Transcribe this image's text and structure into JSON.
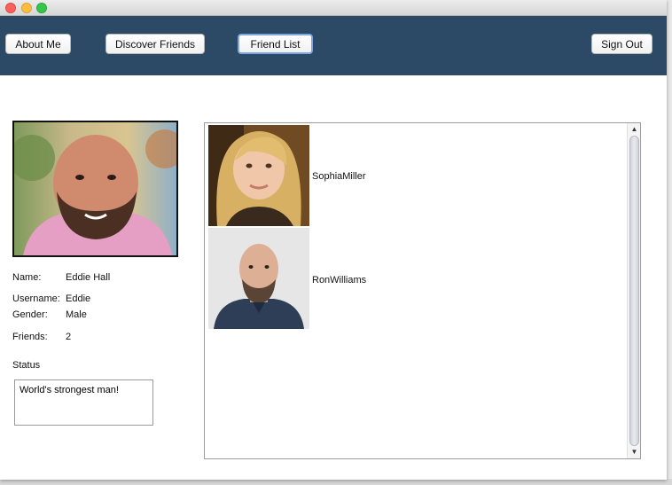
{
  "nav": {
    "about_me": "About Me",
    "discover_friends": "Discover Friends",
    "friend_list": "Friend List",
    "sign_out": "Sign Out"
  },
  "profile": {
    "name_label": "Name:",
    "name_value": "Eddie Hall",
    "username_label": "Username:",
    "username_value": "Eddie",
    "gender_label": "Gender:",
    "gender_value": "Male",
    "friends_label": "Friends:",
    "friends_value": "2",
    "status_label": "Status",
    "status_text": "World's strongest man!"
  },
  "friends": [
    {
      "name": "SophiaMiller"
    },
    {
      "name": "RonWilliams"
    }
  ],
  "colors": {
    "navbar": "#2c4966",
    "active_button_border": "#7ca7df"
  },
  "icons": {
    "scroll_up": "▲",
    "scroll_down": "▼"
  }
}
